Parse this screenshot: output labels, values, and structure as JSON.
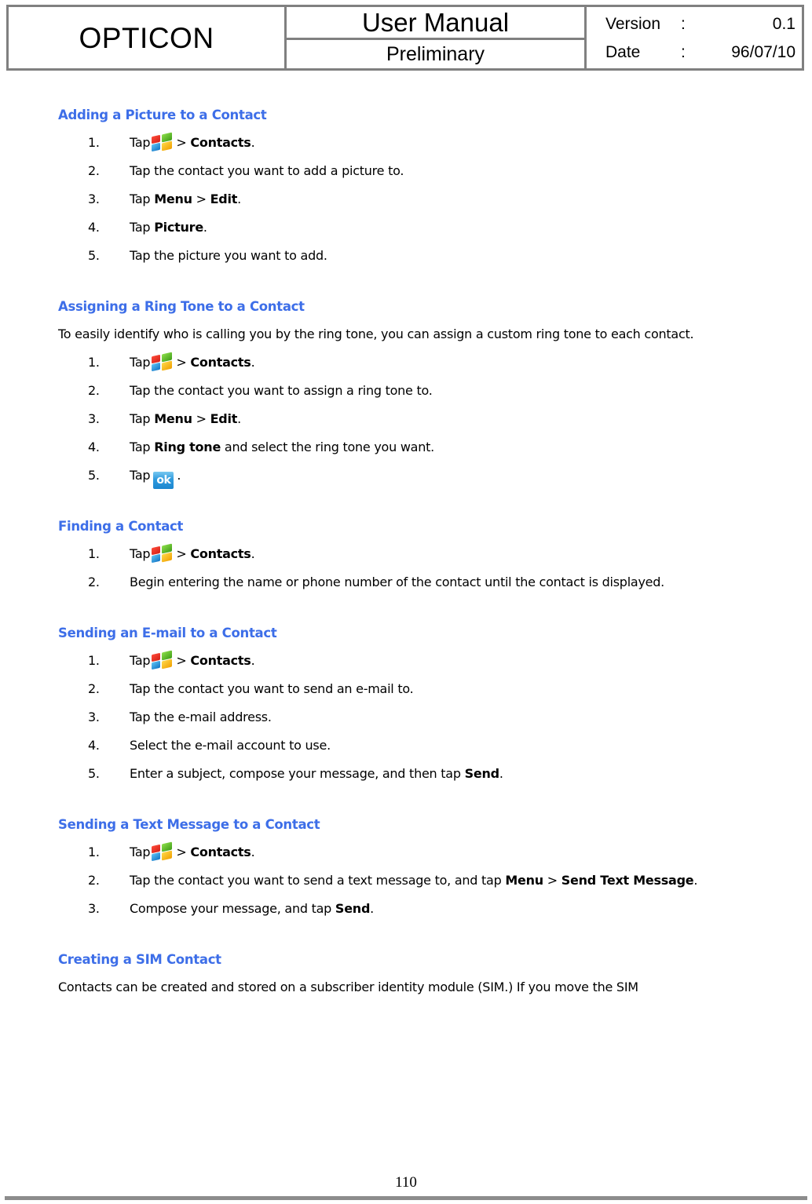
{
  "header": {
    "logo": "OPTICON",
    "title_main": "User Manual",
    "title_sub": "Preliminary",
    "version_label": "Version",
    "version_colon": ":",
    "version_value": "0.1",
    "date_label": "Date",
    "date_colon": ":",
    "date_value": "96/07/10"
  },
  "icons": {
    "windows_start": "windows-flag-icon",
    "ok_button": "ok"
  },
  "colors": {
    "heading_blue": "#3D6EE8",
    "table_border_gray": "#808080",
    "footer_rule_gray": "#8C8C8C"
  },
  "sections": [
    {
      "heading": "Adding a Picture to a Contact",
      "steps": [
        {
          "num": "1.",
          "pre": "Tap",
          "icon": "windows",
          "mid": ">",
          "bold1": "Contacts",
          "post": "."
        },
        {
          "num": "2.",
          "text": "Tap the contact you want to add a picture to."
        },
        {
          "num": "3.",
          "pre": "Tap",
          "bold1": "Menu",
          "mid": ">",
          "bold2": "Edit",
          "post": "."
        },
        {
          "num": "4.",
          "pre": "Tap",
          "bold1": "Picture",
          "post": "."
        },
        {
          "num": "5.",
          "text": "Tap the picture you want to add."
        }
      ]
    },
    {
      "heading": "Assigning a Ring Tone to a Contact",
      "paragraph": "To easily identify who is calling you by the ring tone, you can assign a custom ring tone to each contact.",
      "steps": [
        {
          "num": "1.",
          "pre": "Tap",
          "icon": "windows",
          "mid": ">",
          "bold1": "Contacts",
          "post": "."
        },
        {
          "num": "2.",
          "text": "Tap the contact you want to assign a ring tone to."
        },
        {
          "num": "3.",
          "pre": "Tap",
          "bold1": "Menu",
          "mid": ">",
          "bold2": "Edit",
          "post": "."
        },
        {
          "num": "4.",
          "pre": "Tap",
          "bold1": "Ring tone",
          "post": " and select the ring tone you want."
        },
        {
          "num": "5.",
          "pre": "Tap",
          "icon": "ok",
          "post": "."
        }
      ]
    },
    {
      "heading": "Finding a Contact",
      "steps": [
        {
          "num": "1.",
          "pre": "Tap",
          "icon": "windows",
          "mid": ">",
          "bold1": "Contacts",
          "post": "."
        },
        {
          "num": "2.",
          "text": "Begin entering the name or phone number of the contact until the contact is displayed."
        }
      ]
    },
    {
      "heading": "Sending an E-mail to a Contact",
      "steps": [
        {
          "num": "1.",
          "pre": "Tap",
          "icon": "windows",
          "mid": ">",
          "bold1": "Contacts",
          "post": "."
        },
        {
          "num": "2.",
          "text": "Tap the contact you want to send an e-mail to."
        },
        {
          "num": "3.",
          "text": "Tap the e-mail address."
        },
        {
          "num": "4.",
          "text": "Select the e-mail account to use."
        },
        {
          "num": "5.",
          "pre": "Enter a subject, compose your message, and then tap",
          "bold1": "Send",
          "post": "."
        }
      ]
    },
    {
      "heading": "Sending a Text Message to a Contact",
      "steps": [
        {
          "num": "1.",
          "pre": "Tap",
          "icon": "windows",
          "mid": ">",
          "bold1": "Contacts",
          "post": "."
        },
        {
          "num": "2.",
          "pre": "Tap the contact you want to send a text message to, and tap",
          "bold1": "Menu",
          "mid": ">",
          "bold2": "Send Text Message",
          "post": "."
        },
        {
          "num": "3.",
          "pre": "Compose your message, and tap",
          "bold1": "Send",
          "post": "."
        }
      ]
    },
    {
      "heading": "Creating a SIM Contact",
      "paragraph": "Contacts can be created and stored on a subscriber identity module (SIM.) If you move the SIM"
    }
  ],
  "footer": {
    "page_number": "110"
  }
}
